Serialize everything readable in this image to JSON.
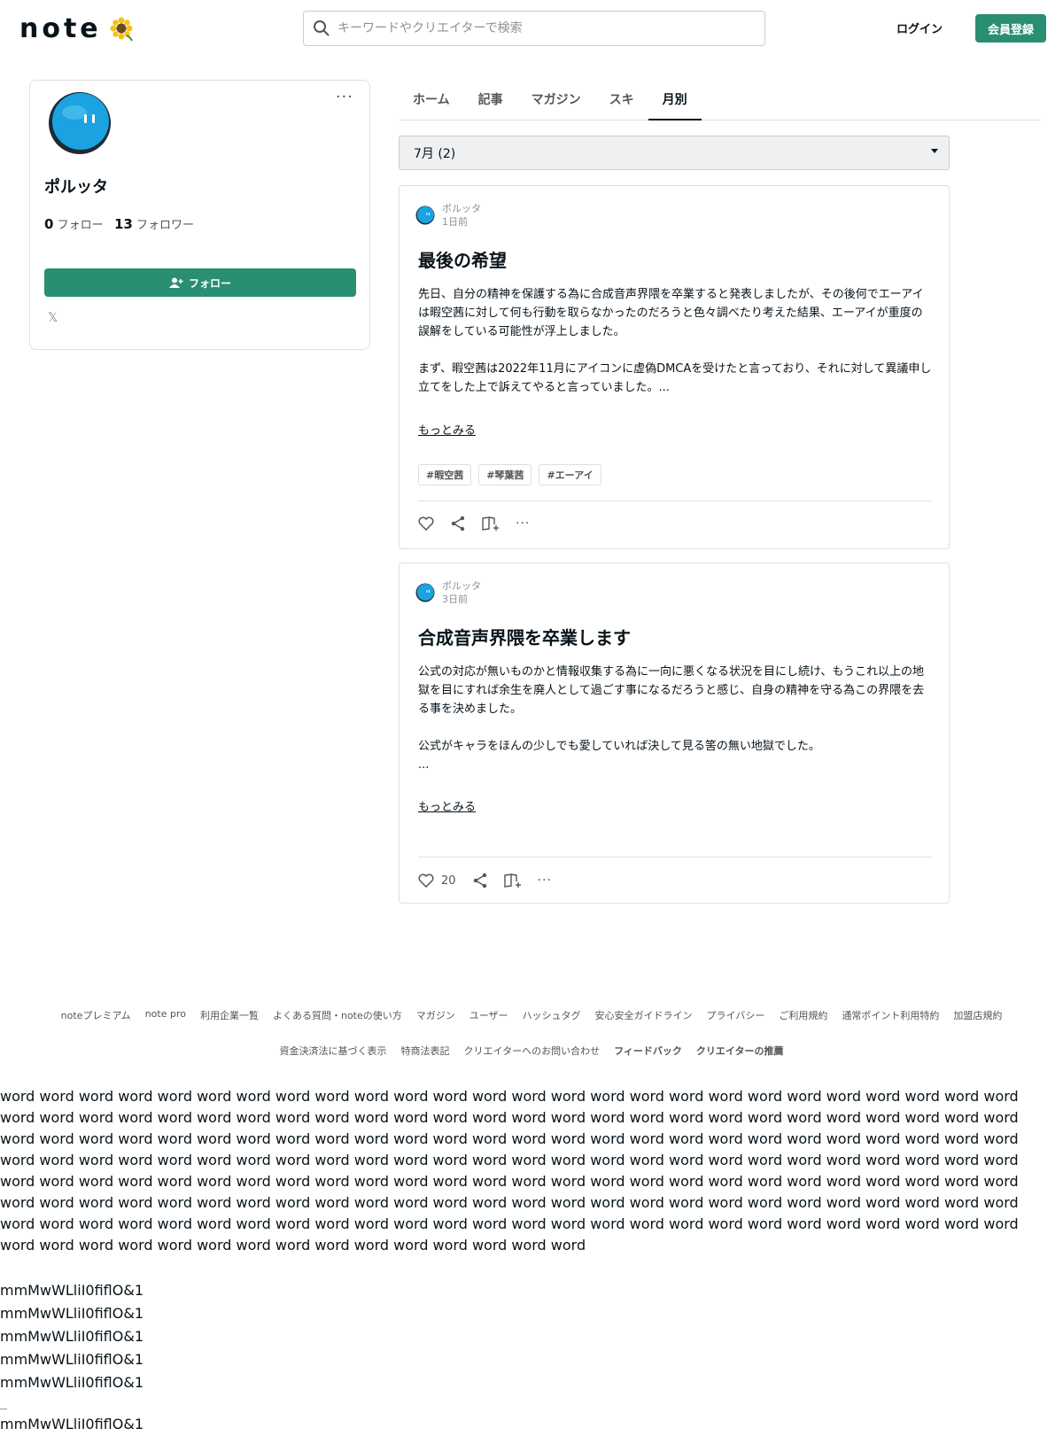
{
  "header": {
    "logo_text": "note",
    "search_placeholder": "キーワードやクリエイターで検索",
    "login": "ログイン",
    "signup": "会員登録"
  },
  "profile": {
    "name": "ポルッタ",
    "following_count": "0",
    "following_label": "フォロー",
    "followers_count": "13",
    "followers_label": "フォロワー",
    "follow_button": "フォロー",
    "menu": "···",
    "x_icon": "𝕏"
  },
  "tabs": [
    {
      "label": "ホーム"
    },
    {
      "label": "記事"
    },
    {
      "label": "マガジン"
    },
    {
      "label": "スキ"
    },
    {
      "label": "月別"
    }
  ],
  "month_select": "7月 (2)",
  "articles": [
    {
      "author": "ポルッタ",
      "time": "1日前",
      "title": "最後の希望",
      "para1": "先日、自分の精神を保護する為に合成音声界隈を卒業すると発表しましたが、その後何でエーアイは暇空茜に対して何も行動を取らなかったのだろうと色々調べたり考えた結果、エーアイが重度の誤解をしている可能性が浮上しました。",
      "para2": "まず、暇空茜は2022年11月にアイコンに虚偽DMCAを受けたと言っており、それに対して異議申し立てをした上で訴えてやると言っていました。...",
      "more": "もっとみる",
      "tags": [
        "#暇空茜",
        "#琴葉茜",
        "#エーアイ"
      ],
      "likes": ""
    },
    {
      "author": "ポルッタ",
      "time": "3日前",
      "title": "合成音声界隈を卒業します",
      "para1": "公式の対応が無いものかと情報収集する為に一向に悪くなる状況を目にし続け、もうこれ以上の地獄を目にすれば余生を廃人として過ごす事になるだろうと感じ、自身の精神を守る為この界隈を去る事を決めました。",
      "para2": "公式がキャラをほんの少しでも愛していれば決して見る筈の無い地獄でした。",
      "para3": "...",
      "more": "もっとみる",
      "likes": "20"
    }
  ],
  "footer": {
    "row1": [
      "noteプレミアム",
      "note pro",
      "利用企業一覧",
      "よくある質問・noteの使い方",
      "マガジン",
      "ユーザー",
      "ハッシュタグ",
      "安心安全ガイドライン",
      "プライバシー",
      "ご利用規約",
      "通常ポイント利用特約",
      "加盟店規約"
    ],
    "row2": [
      "資金決済法に基づく表示",
      "特商法表記",
      "クリエイターへのお問い合わせ"
    ],
    "row2_strong": [
      "フィードバック",
      "クリエイターの推薦"
    ]
  },
  "filler": {
    "words": "word word word word word word word word word word word word word word word word word word word word word word word word word word word word word word word word word word word word word word word word word word word word word word word word word word word word word word word word word word word word word word word word word word word word word word word word word word word word word word word word word word word word word word word word word word word word word word word word word word word word word word word word word word word word word word word word word word word word word word word word word word word word word word word word word word word word word word word word word word word word word word word word word word word word word word word word word word word word word word word word word word word word word word word word word word word word word word word word word word word word word word word word word word word word word word word word word word word word word",
    "glyphs": [
      "mmMwWLliI0fiflO&1",
      "mmMwWLliI0fiflO&1",
      "mmMwWLliI0fiflO&1",
      "mmMwWLliI0fiflO&1",
      "mmMwWLliI0fiflO&1"
    ],
    "glyphs_last": "mmMwWLliI0fiflO&1"
  }
}
